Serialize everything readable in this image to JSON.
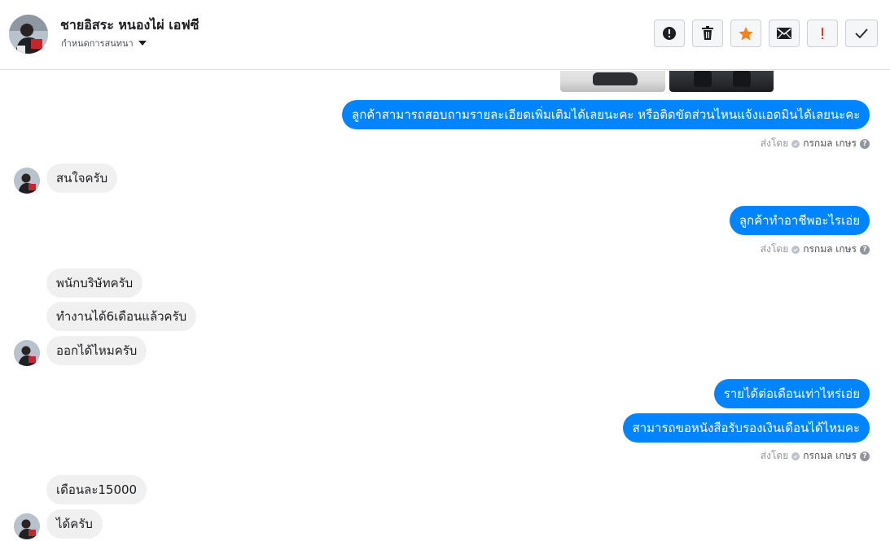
{
  "header": {
    "contact_name": "ชายอิสระ หนองไผ่ เอฟซี",
    "assign_label": "กำหนดการสนทนา",
    "toolbar": [
      {
        "name": "report-spam-button",
        "icon": "alert-circle-icon"
      },
      {
        "name": "delete-button",
        "icon": "trash-icon"
      },
      {
        "name": "star-button",
        "icon": "star-icon",
        "color": "#f5821f"
      },
      {
        "name": "mark-unread-button",
        "icon": "envelope-icon"
      },
      {
        "name": "follow-up-button",
        "icon": "exclamation-icon",
        "color": "#e03c1a"
      },
      {
        "name": "mark-done-button",
        "icon": "checkmark-icon"
      }
    ]
  },
  "colors": {
    "outgoing_bubble": "#0084ff",
    "incoming_bubble": "#f1f0f0",
    "meta_text": "#90949c"
  },
  "messages": {
    "m1": "ลูกค้าสามารถสอบถามรายละเอียดเพิ่มเติมได้เลยนะคะ หรือติดขัดส่วนไหนแจ้งแอดมินได้เลยนะคะ",
    "m2": "สนใจครับ",
    "m3": "ลูกค้าทำอาชีพอะไรเอ่ย",
    "m4": "พนักบริษัทครับ",
    "m5": "ทำงานได้6เดือนแล้วครับ",
    "m6": "ออกได้ไหมครับ",
    "m7": "รายได้ต่อเดือนเท่าไหร่เอ่ย",
    "m8": "สามารถขอหนังสือรับรองเงินเดือนได้ไหมคะ",
    "m9": "เดือนละ15000",
    "m10": "ได้ครับ"
  },
  "sent_by": {
    "prefix": "ส่งโดย",
    "name": "กรกมล เกษร",
    "help": "?"
  }
}
